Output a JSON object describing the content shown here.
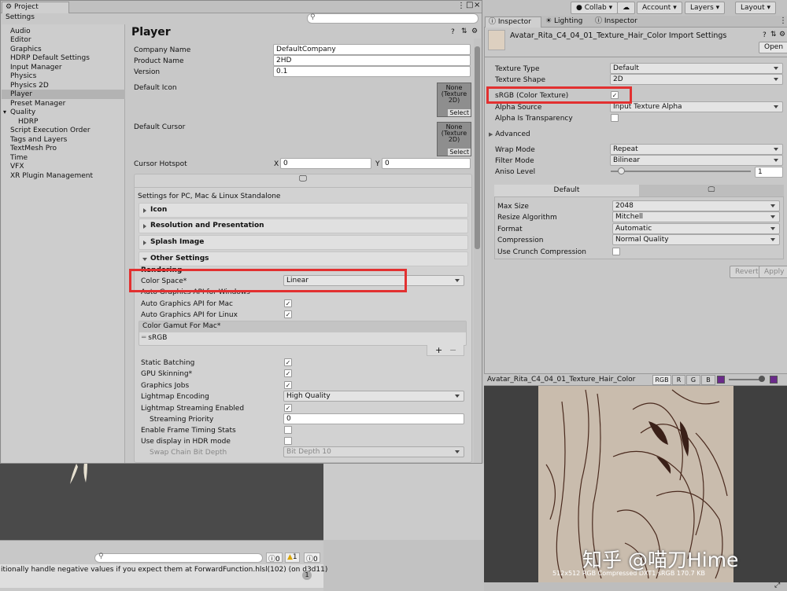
{
  "toolbar": {
    "collab": "Collab",
    "account": "Account",
    "layers": "Layers",
    "layout": "Layout"
  },
  "project_settings": {
    "title": "Project Settings",
    "nav": [
      "Audio",
      "Editor",
      "Graphics",
      "HDRP Default Settings",
      "Input Manager",
      "Physics",
      "Physics 2D",
      "Player",
      "Preset Manager",
      "Quality",
      "HDRP",
      "Script Execution Order",
      "Tags and Layers",
      "TextMesh Pro",
      "Time",
      "VFX",
      "XR Plugin Management"
    ],
    "selected_nav": "Player",
    "player_title": "Player",
    "company_label": "Company Name",
    "company_value": "DefaultCompany",
    "product_label": "Product Name",
    "product_value": "2HD",
    "version_label": "Version",
    "version_value": "0.1",
    "default_icon_label": "Default Icon",
    "default_cursor_label": "Default Cursor",
    "slot_text": "None\n(Texture\n2D)",
    "select_label": "Select",
    "hotspot_label": "Cursor Hotspot",
    "hotspot_x_label": "X",
    "hotspot_x": "0",
    "hotspot_y_label": "Y",
    "hotspot_y": "0",
    "platform_label": "Settings for PC, Mac & Linux Standalone",
    "sections": {
      "icon": "Icon",
      "resolution": "Resolution and Presentation",
      "splash": "Splash Image",
      "other": "Other Settings"
    },
    "rendering_label": "Rendering",
    "color_space_label": "Color Space*",
    "color_space_value": "Linear",
    "auto_win": "Auto Graphics API  for Windows",
    "auto_mac": "Auto Graphics API  for Mac",
    "auto_linux": "Auto Graphics API  for Linux",
    "gamut_header": "Color Gamut For Mac*",
    "gamut_item": "sRGB",
    "plus": "+",
    "minus": "−",
    "static_batching": "Static Batching",
    "gpu_skinning": "GPU Skinning*",
    "graphics_jobs": "Graphics Jobs",
    "lightmap_encoding_label": "Lightmap Encoding",
    "lightmap_encoding_value": "High Quality",
    "lightmap_streaming": "Lightmap Streaming Enabled",
    "streaming_priority_label": "Streaming Priority",
    "streaming_priority_value": "0",
    "frame_timing": "Enable Frame Timing Stats",
    "hdr_display": "Use display in HDR mode",
    "swap_chain_label": "Swap Chain Bit Depth",
    "swap_chain_value": "Bit Depth 10"
  },
  "console": {
    "warn_count": "0",
    "warn2_count": "1",
    "err_count": "0",
    "message": "itionally handle negative values if you expect them at ForwardFunction.hlsl(102) (on d3d11)",
    "badge": "1"
  },
  "inspector": {
    "tabs": [
      "Inspector",
      "Lighting",
      "Inspector"
    ],
    "asset_title": "Avatar_Rita_C4_04_01_Texture_Hair_Color Import Settings",
    "open_label": "Open",
    "texture_type_label": "Texture Type",
    "texture_type_value": "Default",
    "texture_shape_label": "Texture Shape",
    "texture_shape_value": "2D",
    "srgb_label": "sRGB (Color Texture)",
    "alpha_source_label": "Alpha Source",
    "alpha_source_value": "Input Texture Alpha",
    "alpha_transparency_label": "Alpha Is Transparency",
    "advanced_label": "Advanced",
    "wrap_label": "Wrap Mode",
    "wrap_value": "Repeat",
    "filter_label": "Filter Mode",
    "filter_value": "Bilinear",
    "aniso_label": "Aniso Level",
    "aniso_value": "1",
    "default_tab": "Default",
    "max_size_label": "Max Size",
    "max_size_value": "2048",
    "resize_label": "Resize Algorithm",
    "resize_value": "Mitchell",
    "format_label": "Format",
    "format_value": "Automatic",
    "compression_label": "Compression",
    "compression_value": "Normal Quality",
    "crunch_label": "Use Crunch Compression",
    "revert_label": "Revert",
    "apply_label": "Apply"
  },
  "preview": {
    "title": "Avatar_Rita_C4_04_01_Texture_Hair_Color",
    "channels": [
      "RGB",
      "R",
      "G",
      "B"
    ],
    "info": "512x512  RGB Compressed DXT1 sRGB  170.7 KB"
  },
  "watermark": "知乎 @喵刀Hime"
}
